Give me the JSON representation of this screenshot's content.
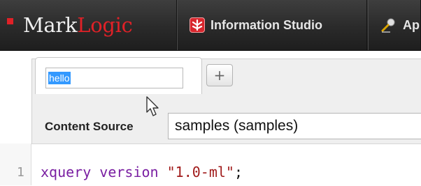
{
  "header": {
    "brand": {
      "mark": "Mark",
      "logic": "Logic"
    },
    "nav_tabs": [
      {
        "label": "Information Studio",
        "icon": "information-studio-icon"
      },
      {
        "label": "Ap",
        "icon": "application-builder-icon"
      }
    ]
  },
  "editor": {
    "query_tab": {
      "name_value": "hello"
    },
    "add_tab_label": "+",
    "content_source": {
      "label": "Content Source",
      "selected": "samples (samples)"
    },
    "code": {
      "line_number": "1",
      "keyword": "xquery version",
      "string": "\"1.0-ml\"",
      "terminator": ";"
    }
  },
  "colors": {
    "brand_red": "#e02127",
    "selection": "#3399ff",
    "keyword": "#7a1fa2",
    "string": "#a11b1b"
  }
}
